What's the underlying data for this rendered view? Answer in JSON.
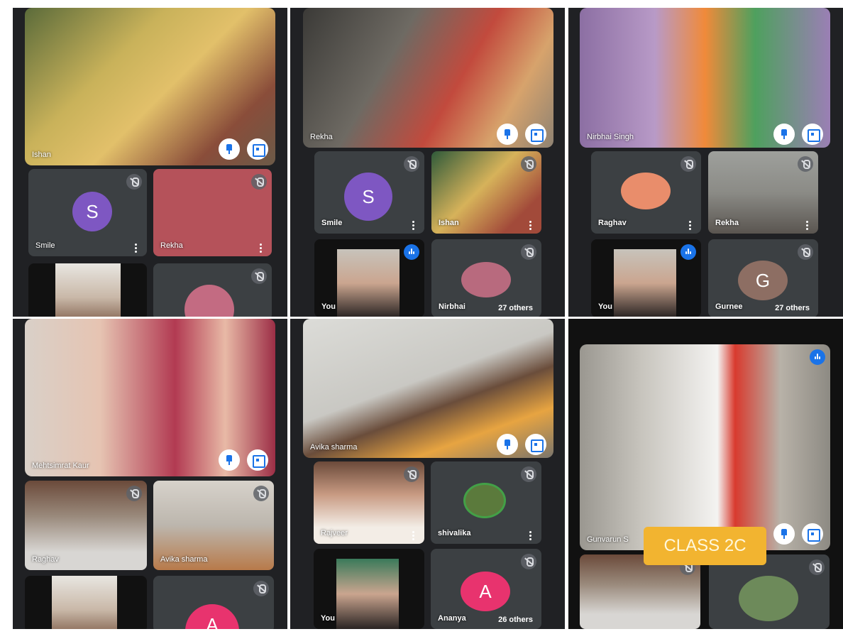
{
  "panels": {
    "p1": {
      "main": {
        "name": "Ishan"
      },
      "tiles": [
        {
          "name": "Smile",
          "avatar_letter": "S"
        },
        {
          "name": "Rekha"
        },
        {
          "name": ""
        },
        {
          "name": ""
        }
      ]
    },
    "p2": {
      "main": {
        "name": "Rekha"
      },
      "tiles": [
        {
          "name": "Smile",
          "avatar_letter": "S"
        },
        {
          "name": "Ishan"
        },
        {
          "name": "You"
        },
        {
          "name": "Nirbhai",
          "others": "27 others"
        }
      ]
    },
    "p3": {
      "main": {
        "name": "Nirbhai Singh"
      },
      "tiles": [
        {
          "name": "Raghav"
        },
        {
          "name": "Rekha"
        },
        {
          "name": "You"
        },
        {
          "name": "Gurnee",
          "others": "27 others",
          "avatar_letter": "G"
        }
      ]
    },
    "p4": {
      "main": {
        "name": "Mehtsimrat Kaur"
      },
      "tiles": [
        {
          "name": "Raghav"
        },
        {
          "name": "Avika sharma"
        },
        {
          "name": ""
        },
        {
          "name": "",
          "avatar_letter": "A"
        }
      ]
    },
    "p5": {
      "main": {
        "name": "Avika sharma"
      },
      "tiles": [
        {
          "name": "Rajveer"
        },
        {
          "name": "shivalika"
        },
        {
          "name": "You"
        },
        {
          "name": "Ananya",
          "others": "26 others",
          "avatar_letter": "A"
        }
      ]
    },
    "p6": {
      "main": {
        "name": "Gunvarun S"
      },
      "tiles": [
        {
          "name": ""
        },
        {
          "name": ""
        }
      ]
    }
  },
  "class_label": "CLASS 2C",
  "colors": {
    "panel_bg": "#202124",
    "tile_bg": "#3c4043",
    "avatar_purple": "#7e57c2",
    "avatar_brown": "#8d6e63",
    "avatar_pink": "#e8336e",
    "accent_blue": "#1a73e8",
    "class_tag": "#f2b430"
  }
}
